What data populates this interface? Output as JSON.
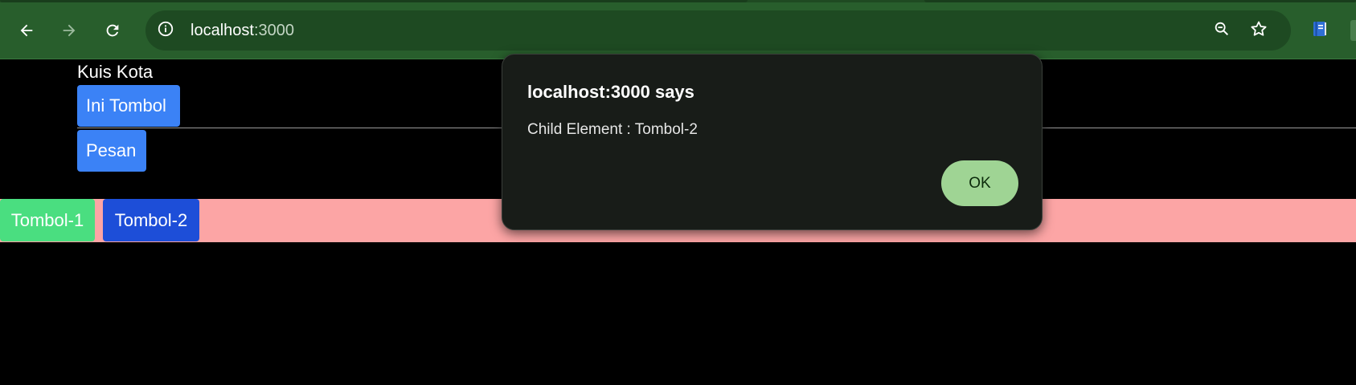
{
  "browser": {
    "url_host": "localhost",
    "url_port": ":3000",
    "icons": {
      "back": "back-arrow-icon",
      "forward": "forward-arrow-icon",
      "reload": "reload-icon",
      "site_info": "info-icon",
      "zoom": "zoom-out-icon",
      "bookmark": "star-icon",
      "extension": "book-icon"
    },
    "colors": {
      "toolbar": "#285e2c",
      "omnibox": "#1e4a22"
    }
  },
  "page": {
    "title": "Kuis Kota",
    "button_ini_tombol": "Ini Tombol",
    "button_pesan": "Pesan",
    "button_tombol_1": "Tombol-1",
    "button_tombol_2": "Tombol-2",
    "colors": {
      "blue_button": "#3b82f6",
      "green_button": "#4ade80",
      "dark_blue_button": "#1d4ed8",
      "pink_bar": "#fca5a5"
    }
  },
  "dialog": {
    "title": "localhost:3000 says",
    "message": "Child Element : Tombol-2",
    "ok_label": "OK",
    "colors": {
      "background": "#181c18",
      "ok_button": "#9fd494"
    }
  }
}
